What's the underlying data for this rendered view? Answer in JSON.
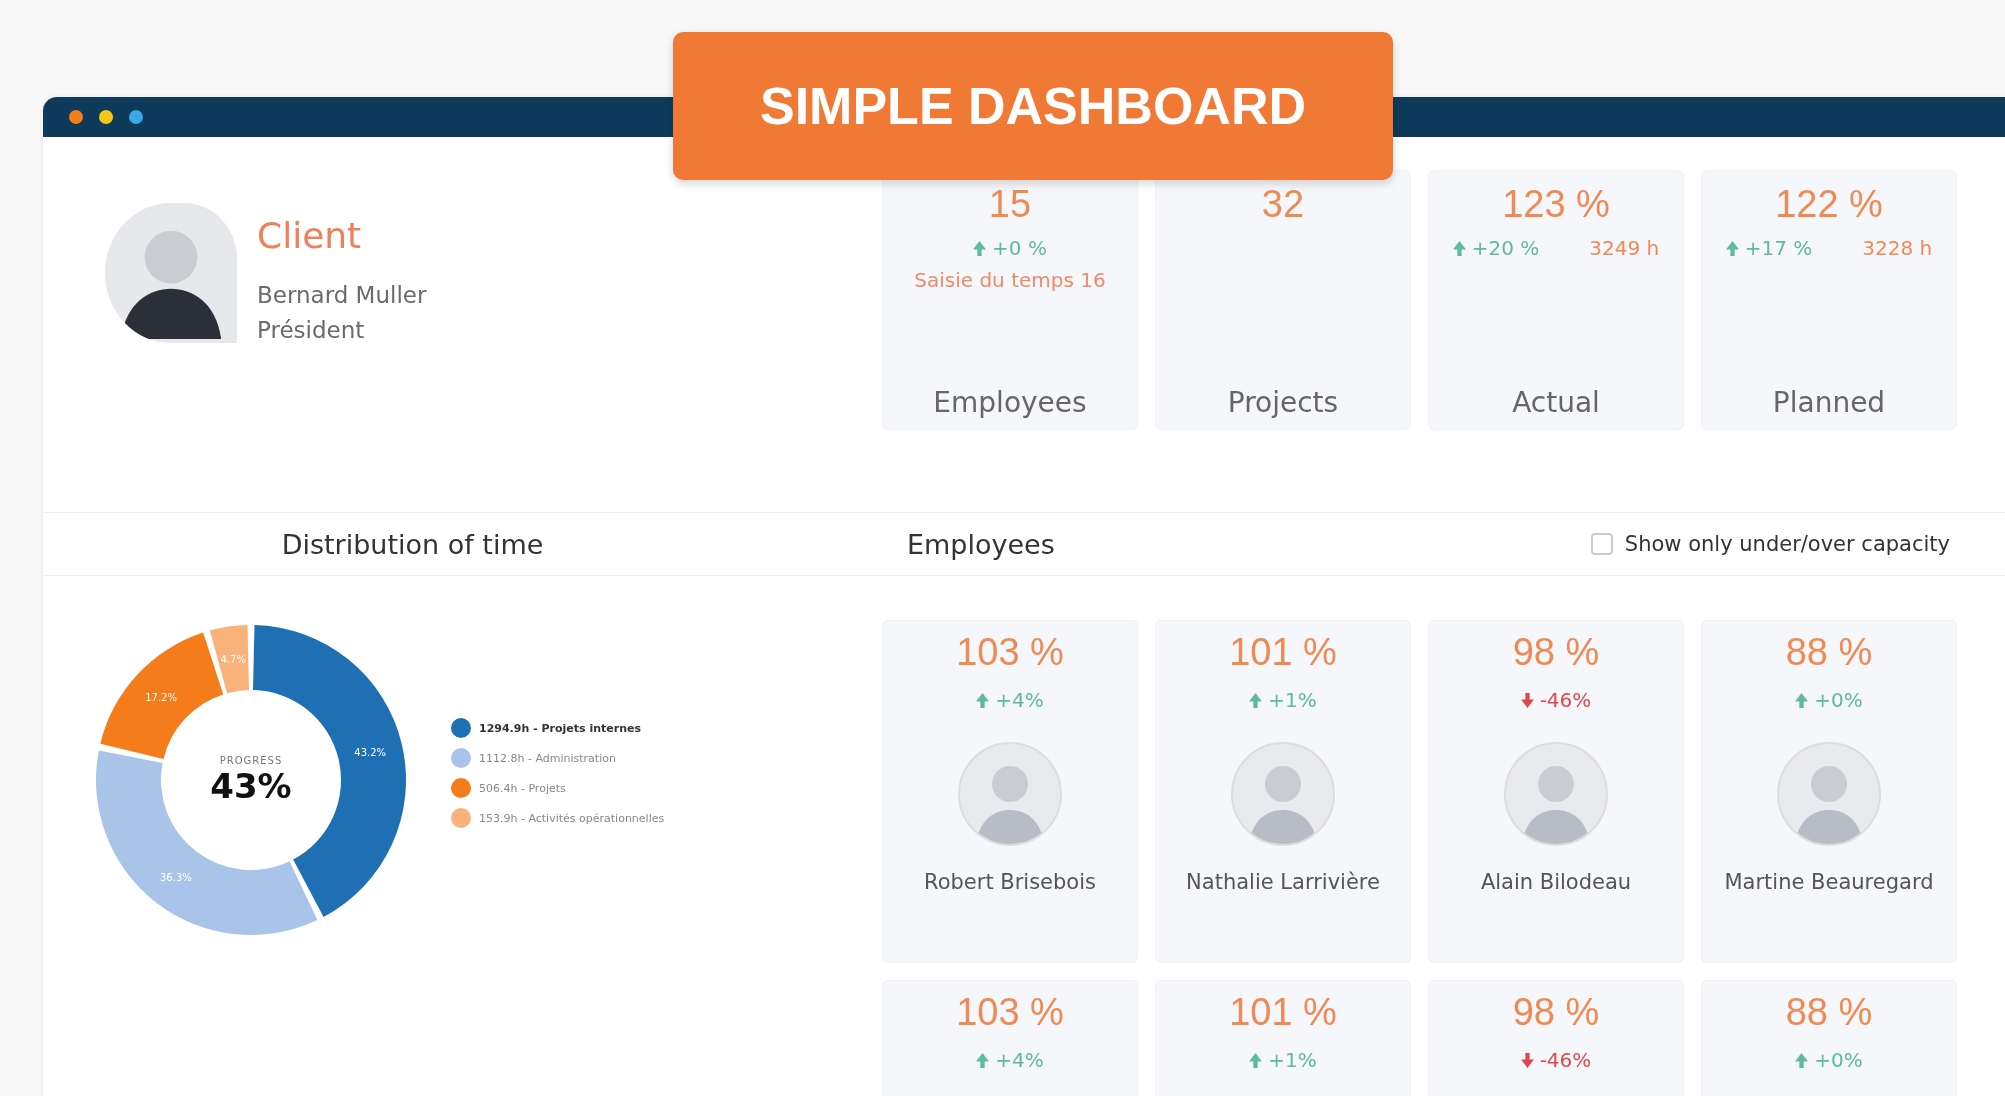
{
  "banner": {
    "title": "SIMPLE DASHBOARD"
  },
  "client": {
    "heading": "Client",
    "name": "Bernard Muller",
    "role": "Président"
  },
  "stats": [
    {
      "value": "15",
      "change": {
        "kind": "up",
        "text": "+0 %"
      },
      "note": "Saisie du temps 16",
      "label": "Employees"
    },
    {
      "value": "32",
      "label": "Projects"
    },
    {
      "value": "123 %",
      "change": {
        "kind": "up",
        "text": "+20 %"
      },
      "hours": "3249 h",
      "label": "Actual"
    },
    {
      "value": "122 %",
      "change": {
        "kind": "up",
        "text": "+17 %"
      },
      "hours": "3228 h",
      "label": "Planned"
    }
  ],
  "distribution": {
    "title": "Distribution of time",
    "center_label": "PROGRESS",
    "center_value": "43%",
    "legend": [
      {
        "text": "1294.9h - Projets internes",
        "color": "#1f6fb4"
      },
      {
        "text": "1112.8h - Administration",
        "color": "#a9c4e8"
      },
      {
        "text": "506.4h - Projets",
        "color": "#f47c1a"
      },
      {
        "text": "153.9h - Activités opérationnelles",
        "color": "#f9b37a"
      }
    ],
    "chart_data": {
      "type": "donut",
      "values": [
        43.2,
        36.3,
        17.2,
        4.7
      ],
      "value_labels": [
        "43.2%",
        "36.3%",
        "17.2%",
        "4.7%"
      ]
    }
  },
  "employees": {
    "title": "Employees",
    "filter": {
      "label": "Show only under/over capacity",
      "checked": false
    },
    "cards": [
      {
        "value": "103 %",
        "change": {
          "kind": "up",
          "text": "+4%"
        },
        "name": "Robert Brisebois"
      },
      {
        "value": "101 %",
        "change": {
          "kind": "up",
          "text": "+1%"
        },
        "name": "Nathalie Larrivière"
      },
      {
        "value": "98 %",
        "change": {
          "kind": "down",
          "text": "-46%"
        },
        "name": "Alain Bilodeau"
      },
      {
        "value": "88 %",
        "change": {
          "kind": "up",
          "text": "+0%"
        },
        "name": "Martine Beauregard"
      },
      {
        "value": "103 %",
        "change": {
          "kind": "up",
          "text": "+4%"
        }
      },
      {
        "value": "101 %",
        "change": {
          "kind": "up",
          "text": "+1%"
        }
      },
      {
        "value": "98 %",
        "change": {
          "kind": "down",
          "text": "-46%"
        }
      },
      {
        "value": "88 %",
        "change": {
          "kind": "up",
          "text": "+0%"
        }
      }
    ]
  }
}
